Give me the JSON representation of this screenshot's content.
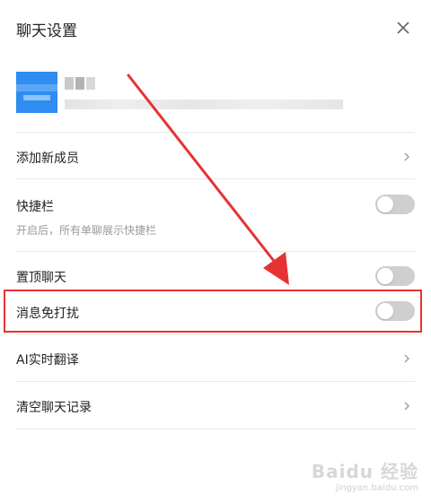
{
  "header": {
    "title": "聊天设置",
    "close_icon": "close-icon"
  },
  "profile": {
    "avatar_color": "#2f8cf0"
  },
  "rows": {
    "add_member": {
      "label": "添加新成员"
    },
    "shortcut_bar": {
      "label": "快捷栏",
      "sub": "开启后，所有单聊展示快捷栏",
      "enabled": false
    },
    "pin_chat": {
      "label": "置顶聊天",
      "enabled": false
    },
    "do_not_disturb": {
      "label": "消息免打扰",
      "enabled": false
    },
    "ai_translate": {
      "label": "AI实时翻译"
    },
    "clear_history": {
      "label": "清空聊天记录"
    }
  },
  "annotation": {
    "color": "#e53333"
  },
  "watermark": {
    "logo": "Baidu 经验",
    "url": "jingyan.baidu.com"
  },
  "colors": {
    "toggle_off": "#cfcfcf",
    "divider": "#e9e9e9",
    "subtext": "#9b9b9b"
  }
}
